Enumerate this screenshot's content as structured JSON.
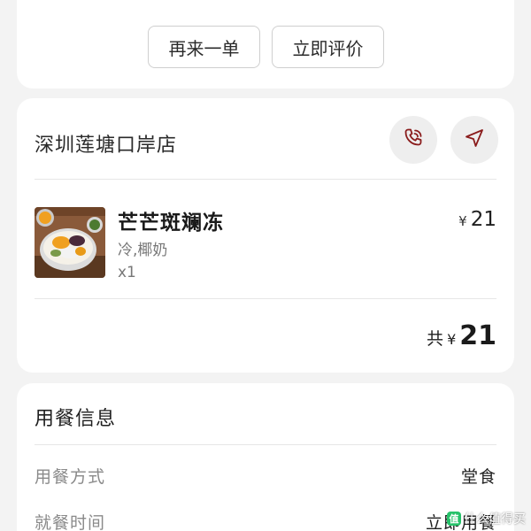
{
  "actions": {
    "reorder_label": "再来一单",
    "review_label": "立即评价"
  },
  "store": {
    "name": "深圳莲塘口岸店",
    "phone_icon": "phone-icon",
    "navigate_icon": "navigation-arrow-icon",
    "accent_color": "#8a1c1c"
  },
  "order": {
    "items": [
      {
        "name": "芒芒斑斓冻",
        "spec": "冷,椰奶",
        "qty": "x1",
        "currency": "¥",
        "price": "21"
      }
    ],
    "total_label": "共",
    "total_currency": "¥",
    "total_amount": "21"
  },
  "dining_info": {
    "title": "用餐信息",
    "rows": [
      {
        "key": "用餐方式",
        "value": "堂食"
      },
      {
        "key": "就餐时间",
        "value": "立即用餐"
      }
    ]
  },
  "watermark": {
    "text": "什么值得买"
  }
}
